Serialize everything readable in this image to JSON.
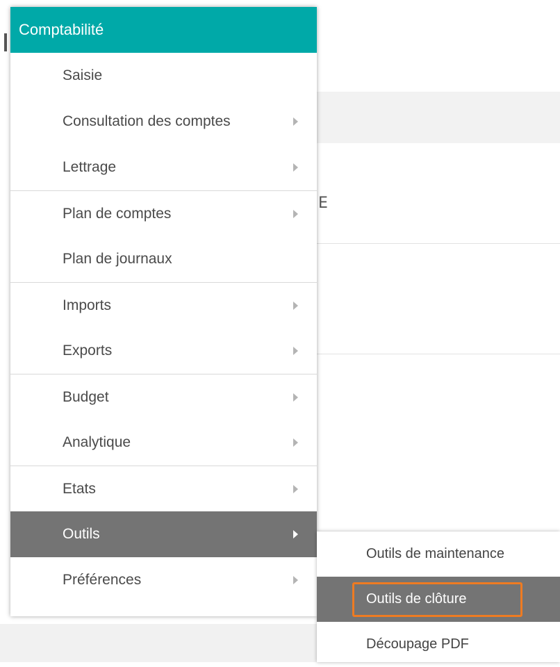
{
  "menu": {
    "title": "Comptabilité",
    "items": [
      {
        "label": "Saisie",
        "has_submenu": false
      },
      {
        "label": "Consultation des comptes",
        "has_submenu": true
      },
      {
        "label": "Lettrage",
        "has_submenu": true
      },
      {
        "label": "Plan de comptes",
        "has_submenu": true
      },
      {
        "label": "Plan de journaux",
        "has_submenu": false
      },
      {
        "label": "Imports",
        "has_submenu": true
      },
      {
        "label": "Exports",
        "has_submenu": true
      },
      {
        "label": "Budget",
        "has_submenu": true
      },
      {
        "label": "Analytique",
        "has_submenu": true
      },
      {
        "label": "Etats",
        "has_submenu": true
      },
      {
        "label": "Outils",
        "has_submenu": true,
        "active": true
      },
      {
        "label": "Préférences",
        "has_submenu": true
      }
    ]
  },
  "submenu": {
    "items": [
      {
        "label": "Outils de maintenance"
      },
      {
        "label": "Outils de clôture",
        "active": true,
        "highlighted": true
      },
      {
        "label": "Découpage PDF"
      }
    ]
  },
  "colors": {
    "header": "#00a9a8",
    "active_item": "#747474",
    "highlight_border": "#ee7b22"
  }
}
